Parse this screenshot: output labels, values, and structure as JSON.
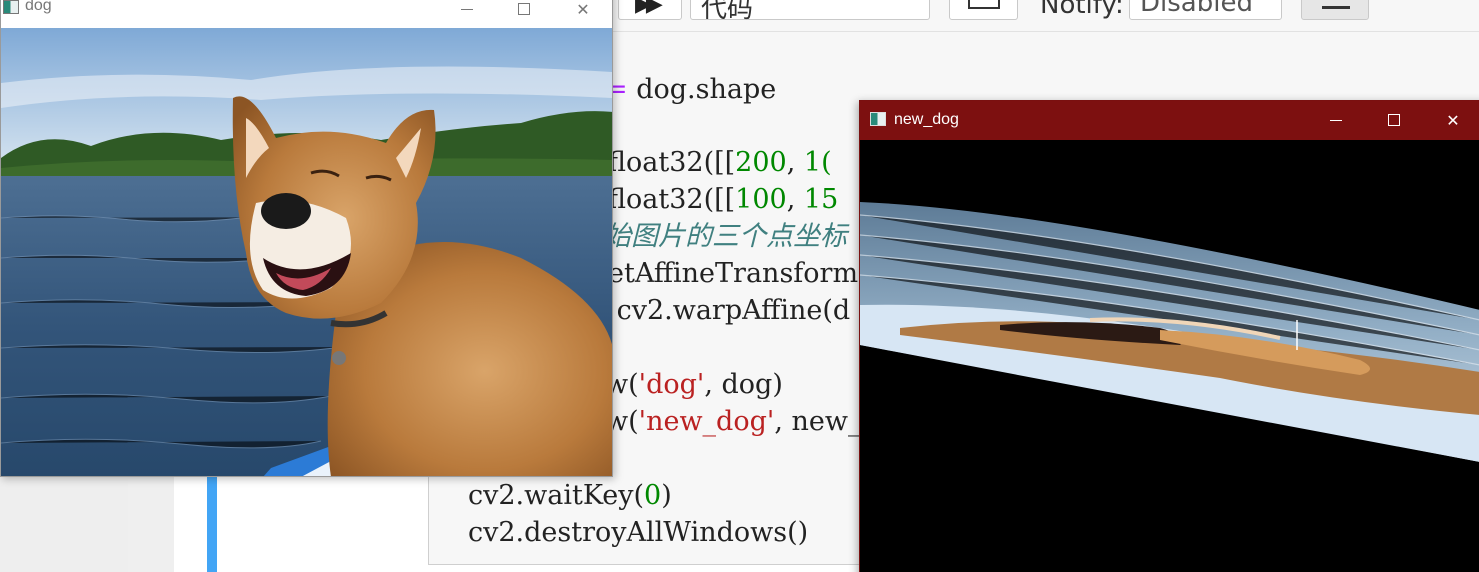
{
  "toolbar": {
    "run_all_glyph": "▶▶",
    "cell_type_value": "代码",
    "keyboard_icon": "keyboard-icon",
    "notify_label": "Notify:",
    "notify_value": "Disabled",
    "list_icon": "list-icon"
  },
  "code_cell": {
    "lines": {
      "l1_op": "=",
      "l1_text": " dog.shape",
      "l2_a": "float32([[",
      "l2_n1": "200",
      "l2_b": ", ",
      "l2_n2": "1(",
      "l3_a": "float32([[",
      "l3_n1": "100",
      "l3_b": ", ",
      "l3_n2": "15",
      "l4_comment": "始图片的三个点坐标",
      "l5": "etAffineTransform",
      "l6": " cv2.warpAffine(d",
      "l7_a": "w(",
      "l7_str": "'dog'",
      "l7_b": ", dog)",
      "l8_a": "w(",
      "l8_str": "'new_dog'",
      "l8_b": ", new_",
      "l9_a": "cv2.waitKey(",
      "l9_num": "0",
      "l9_b": ")",
      "l10": "cv2.destroyAllWindows()"
    }
  },
  "dog_window": {
    "title": "dog",
    "min_label": "",
    "max_label": "",
    "close_label": "✕"
  },
  "newdog_window": {
    "title": "new_dog",
    "min_label": "",
    "max_label": "",
    "close_label": "✕"
  },
  "colors": {
    "active_titlebar": "#7d1010",
    "cell_selected_bar": "#42a5f5",
    "code_number": "#008800",
    "code_string": "#ba2121",
    "code_operator": "#aa22ff",
    "code_comment": "#408080"
  }
}
